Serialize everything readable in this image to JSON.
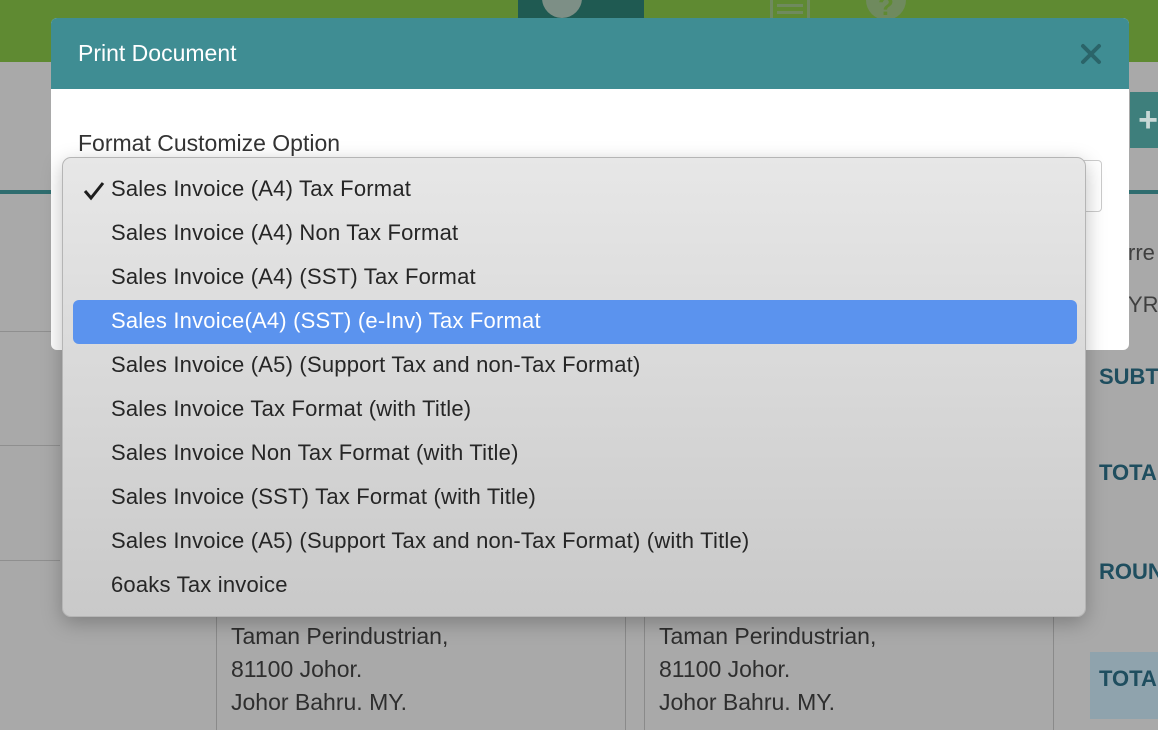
{
  "background": {
    "address_left": [
      "Taman Perindustrian,",
      "81100 Johor.",
      "Johor Bahru. MY."
    ],
    "address_right": [
      "Taman Perindustrian,",
      "81100 Johor.",
      "Johor Bahru. MY."
    ],
    "side_labels": [
      "SUBT",
      "TOTA",
      "ROUN",
      "TOTA"
    ],
    "side_texts": [
      "rre",
      "YR"
    ]
  },
  "modal": {
    "title": "Print Document",
    "form_label": "Format Customize Option"
  },
  "dropdown": {
    "checked_index": 0,
    "highlighted_index": 3,
    "options": [
      "Sales Invoice (A4) Tax Format",
      "Sales Invoice (A4) Non Tax Format",
      "Sales Invoice (A4) (SST) Tax Format",
      "Sales Invoice(A4) (SST) (e-Inv) Tax Format",
      "Sales Invoice (A5) (Support Tax and non-Tax Format)",
      "Sales Invoice Tax Format (with Title)",
      "Sales Invoice Non Tax Format (with Title)",
      "Sales Invoice (SST) Tax Format (with Title)",
      "Sales Invoice (A5) (Support Tax and non-Tax Format) (with Title)",
      "6oaks Tax invoice"
    ]
  },
  "colors": {
    "header_teal": "#3f8d93",
    "selection_blue": "#5b93ee",
    "topbar_green": "#5f8a32"
  }
}
